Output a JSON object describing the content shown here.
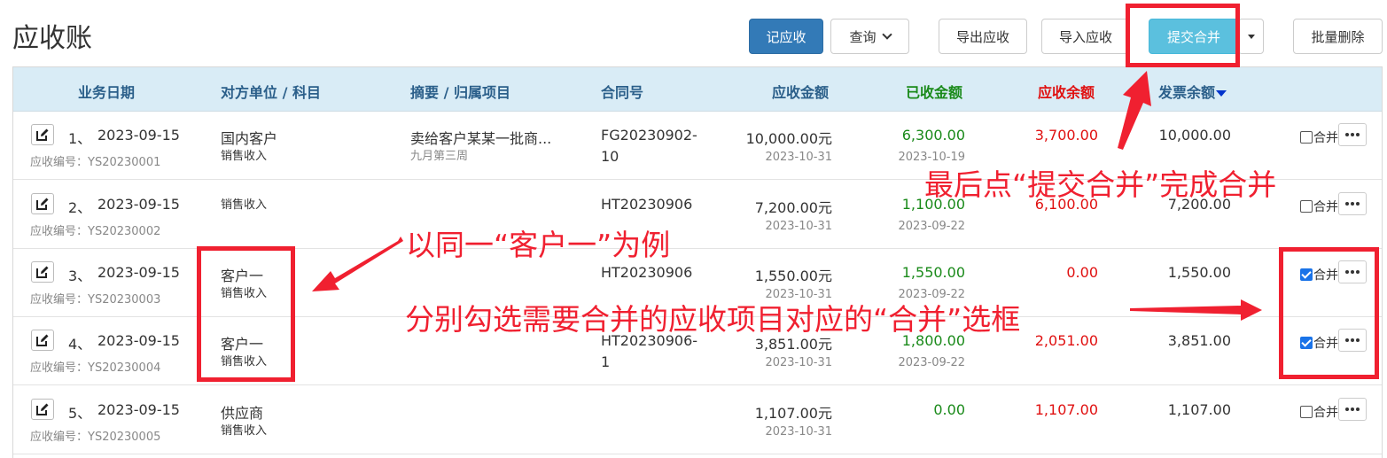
{
  "page": {
    "title": "应收账"
  },
  "toolbar": {
    "record": "记应收",
    "query": "查询",
    "export": "导出应收",
    "import": "导入应收",
    "submit_merge": "提交合并",
    "batch_delete": "批量删除"
  },
  "table": {
    "headers": {
      "date": "业务日期",
      "party": "对方单位 / 科目",
      "summary": "摘要 / 归属项目",
      "contract": "合同号",
      "amount": "应收金额",
      "received": "已收金额",
      "balance": "应收余额",
      "invoice": "发票余额"
    },
    "rows": [
      {
        "no": "1、",
        "date": "2023-09-15",
        "code": "应收编号：YS20230001",
        "party": "国内客户",
        "subject": "销售收入",
        "summary": "卖给客户某某一批商...",
        "project": "九月第三周",
        "contract1": "FG20230902-",
        "contract2": "10",
        "amount": "10,000.00元",
        "due": "2023-10-31",
        "received": "6,300.00",
        "recv_date": "2023-10-19",
        "balance": "3,700.00",
        "invoice": "10,000.00",
        "merge_label": "合并",
        "checked": false
      },
      {
        "no": "2、",
        "date": "2023-09-15",
        "code": "应收编号：YS20230002",
        "party": "",
        "subject": "销售收入",
        "summary": "",
        "project": "",
        "contract1": "HT20230906",
        "contract2": "",
        "amount": "7,200.00元",
        "due": "2023-10-31",
        "received": "1,100.00",
        "recv_date": "2023-09-22",
        "balance": "6,100.00",
        "invoice": "7,200.00",
        "merge_label": "合并",
        "checked": false
      },
      {
        "no": "3、",
        "date": "2023-09-15",
        "code": "应收编号：YS20230003",
        "party": "客户一",
        "subject": "销售收入",
        "summary": "",
        "project": "",
        "contract1": "HT20230906",
        "contract2": "",
        "amount": "1,550.00元",
        "due": "2023-10-31",
        "received": "1,550.00",
        "recv_date": "2023-09-22",
        "balance": "0.00",
        "invoice": "1,550.00",
        "merge_label": "合并",
        "checked": true
      },
      {
        "no": "4、",
        "date": "2023-09-15",
        "code": "应收编号：YS20230004",
        "party": "客户一",
        "subject": "销售收入",
        "summary": "",
        "project": "",
        "contract1": "HT20230906-",
        "contract2": "1",
        "amount": "3,851.00元",
        "due": "2023-10-31",
        "received": "1,800.00",
        "recv_date": "2023-09-22",
        "balance": "2,051.00",
        "invoice": "3,851.00",
        "merge_label": "合并",
        "checked": true
      },
      {
        "no": "5、",
        "date": "2023-09-15",
        "code": "应收编号：YS20230005",
        "party": "供应商",
        "subject": "销售收入",
        "summary": "",
        "project": "",
        "contract1": "",
        "contract2": "",
        "amount": "1,107.00元",
        "due": "2023-10-31",
        "received": "0.00",
        "recv_date": "",
        "balance": "1,107.00",
        "invoice": "1,107.00",
        "merge_label": "合并",
        "checked": false
      }
    ]
  },
  "annotations": {
    "final_step": "最后点“提交合并”完成合并",
    "example": "以同一“客户一”为例",
    "instruction": "分别勾选需要合并的应收项目对应的“合并”选框"
  },
  "colors": {
    "annotation": "#f02030",
    "primary": "#337ab7",
    "info": "#5bc0de",
    "header_bg": "#d9ecf6",
    "green": "#1a8a1a",
    "red": "#e01010"
  }
}
